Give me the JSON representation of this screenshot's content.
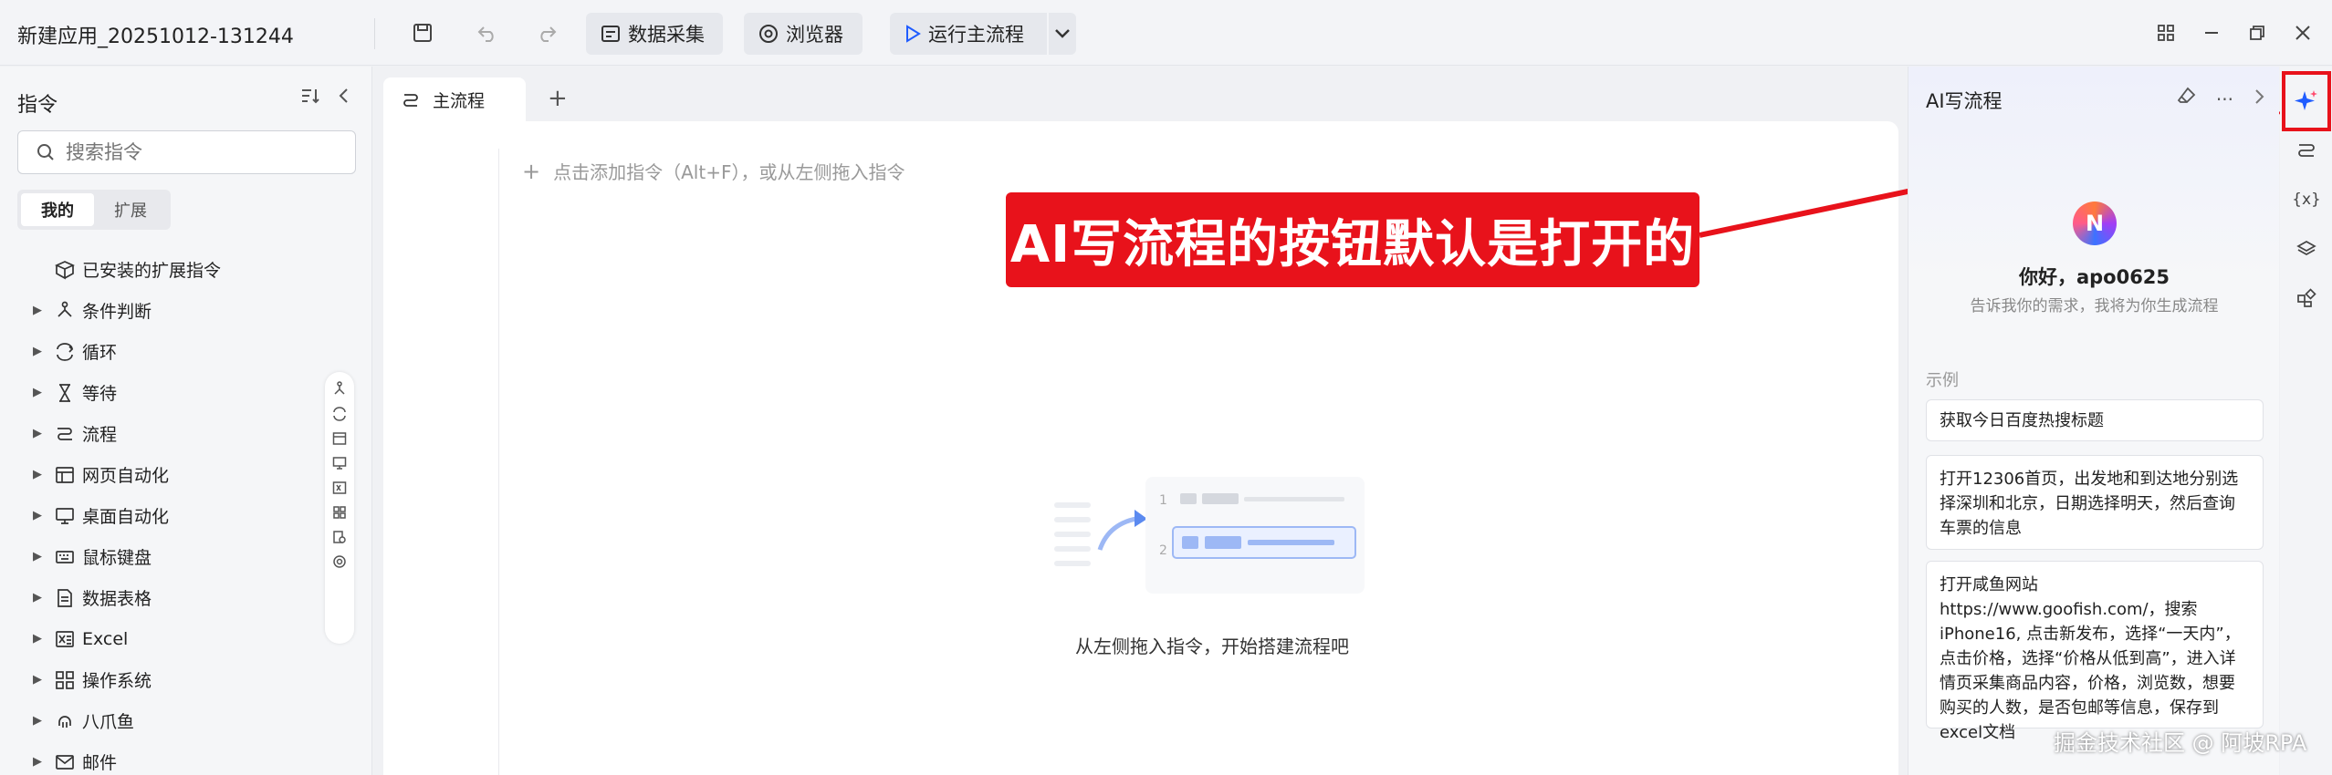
{
  "titlebar": {
    "app_title": "新建应用_20251012-131244",
    "data_collect_label": "数据采集",
    "browser_label": "浏览器",
    "run_label": "运行主流程"
  },
  "left_panel": {
    "title": "指令",
    "search_placeholder": "搜索指令",
    "tabs": [
      "我的",
      "扩展"
    ],
    "tree": [
      {
        "label": "已安装的扩展指令",
        "icon": "package-icon",
        "expandable": false
      },
      {
        "label": "条件判断",
        "icon": "branch-icon",
        "expandable": true
      },
      {
        "label": "循环",
        "icon": "loop-icon",
        "expandable": true
      },
      {
        "label": "等待",
        "icon": "hourglass-icon",
        "expandable": true
      },
      {
        "label": "流程",
        "icon": "flow-icon",
        "expandable": true
      },
      {
        "label": "网页自动化",
        "icon": "webpage-icon",
        "expandable": true
      },
      {
        "label": "桌面自动化",
        "icon": "desktop-icon",
        "expandable": true
      },
      {
        "label": "鼠标键盘",
        "icon": "keyboard-icon",
        "expandable": true
      },
      {
        "label": "数据表格",
        "icon": "document-icon",
        "expandable": true
      },
      {
        "label": "Excel",
        "icon": "excel-icon",
        "expandable": true
      },
      {
        "label": "操作系统",
        "icon": "apps-icon",
        "expandable": true
      },
      {
        "label": "八爪鱼",
        "icon": "octopus-icon",
        "expandable": true
      },
      {
        "label": "邮件",
        "icon": "mail-icon",
        "expandable": true
      }
    ]
  },
  "center": {
    "tab_label": "主流程",
    "add_hint": "点击添加指令（Alt+F），或从左侧拖入指令",
    "empty_text": "从左侧拖入指令，开始搭建流程吧",
    "illus_steps": [
      "1",
      "2"
    ]
  },
  "callout": {
    "text": "AI写流程的按钮默认是打开的"
  },
  "right_panel": {
    "title": "AI写流程",
    "greeting": "你好，apo0625",
    "greeting_sub": "告诉我你的需求，我将为你生成流程",
    "examples_label": "示例",
    "examples": [
      "获取今日百度热搜标题",
      "打开12306首页，出发地和到达地分别选择深圳和北京，日期选择明天，然后查询车票的信息",
      "打开咸鱼网站https://www.goofish.com/，搜索iPhone16, 点击新发布，选择“一天内”，点击价格，选择“价格从低到高”，进入详情页采集商品内容，价格，浏览数，想要购买的人数，是否包邮等信息，保存到excel文档"
    ],
    "more_label": "···"
  },
  "rail": {
    "variable_label": "{x}"
  },
  "watermark": "掘金技术社区 @ 阿坡RPA",
  "colors": {
    "accent": "#1f5cff",
    "callout_red": "#e8121b"
  }
}
